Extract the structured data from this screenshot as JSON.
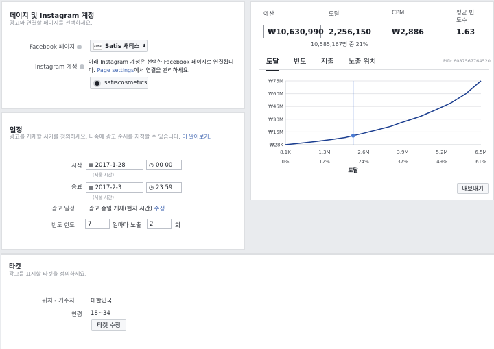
{
  "page_ig": {
    "title": "페이지 및 Instagram 계정",
    "subtitle": "광고와 연결할 페이지를 선택하세요.",
    "facebook_label": "Facebook 페이지",
    "facebook_page_name": "Satis 새티스",
    "facebook_page_logo": "satis",
    "instagram_label": "Instagram 계정",
    "instagram_desc_line1": "아래 Instagram 계정은 선택한 Facebook 페이지로 연결됩니",
    "instagram_desc_line2_prefix": "다. ",
    "instagram_desc_link": "Page settings",
    "instagram_desc_line2_suffix": "에서 연결을 관리하세요.",
    "instagram_account": "satiscosmetics"
  },
  "schedule": {
    "title": "일정",
    "subtitle": "광고를 게재할 시기를 정의하세요. 나중에 광고 순서를 지정할 수 있습니다. ",
    "subtitle_link": "더 알아보기.",
    "start_label": "시작",
    "start_tz": "(서울 시간)",
    "start_date": "2017-1-28",
    "start_time": "00  00",
    "end_label": "종료",
    "end_tz": "(서울 시간)",
    "end_date": "2017-2-3",
    "end_time": "23  59",
    "ad_schedule_label": "광고 일정",
    "ad_schedule_value": "광고 종일 게재(현지 시간)",
    "ad_schedule_edit": "수정",
    "freq_label": "빈도 한도",
    "freq_days": "7",
    "freq_mid": "일마다 노출",
    "freq_times": "2",
    "freq_suffix": "회"
  },
  "audience": {
    "title": "타겟",
    "subtitle": "광고를 표시할 타겟을 정의하세요.",
    "location_label": "위치 - 거주지",
    "location_value": "대한민국",
    "age_label": "연령",
    "age_value": "18~34",
    "edit_button": "타겟 수정"
  },
  "metrics": {
    "budget_label": "예산",
    "budget_value": "₩10,630,990",
    "reach_label": "도달",
    "reach_value": "2,256,150",
    "reach_note": "10,585,167명 중 21%",
    "cpm_label": "CPM",
    "cpm_value": "₩2,886",
    "freq_label_line1": "평균 빈",
    "freq_label_line2": "도수",
    "freq_value": "1.63"
  },
  "tabs": {
    "items": [
      "도달",
      "빈도",
      "지출",
      "노출 위치"
    ],
    "active": "도달",
    "pid": "PID: 6087567764520"
  },
  "export_button": "내보내기",
  "colors": {
    "accent": "#4267b2",
    "line": "#1a3d8f",
    "marker": "#4a7bd4"
  },
  "chart_data": {
    "type": "line",
    "title": "",
    "xlabel": "도달",
    "ylabel": "",
    "x_tick_labels": [
      "8.1K",
      "1.3M",
      "2.6M",
      "3.9M",
      "5.2M",
      "6.5M"
    ],
    "x_pct_labels": [
      "0%",
      "12%",
      "24%",
      "37%",
      "49%",
      "61%"
    ],
    "y_tick_labels": [
      "₩75M",
      "₩60M",
      "₩45M",
      "₩30M",
      "₩15M",
      "₩28K"
    ],
    "y_values_millions": [
      75,
      60,
      45,
      30,
      15,
      0.028
    ],
    "xlim_millions": [
      0.0081,
      6.5
    ],
    "ylim_millions": [
      0,
      75
    ],
    "series": [
      {
        "x": [
          0.0081,
          0.5,
          1.0,
          1.5,
          2.0,
          2.256,
          2.6,
          3.0,
          3.5,
          3.9,
          4.5,
          5.0,
          5.5,
          6.0,
          6.5
        ],
        "y": [
          0.028,
          1.8,
          3.7,
          6.0,
          8.5,
          10.63,
          13.5,
          17.0,
          21.5,
          26.5,
          33.5,
          41.0,
          49.0,
          60.0,
          75.0
        ]
      }
    ],
    "marker": {
      "x": 2.256,
      "y": 10.63
    },
    "grid": "horizontal"
  }
}
